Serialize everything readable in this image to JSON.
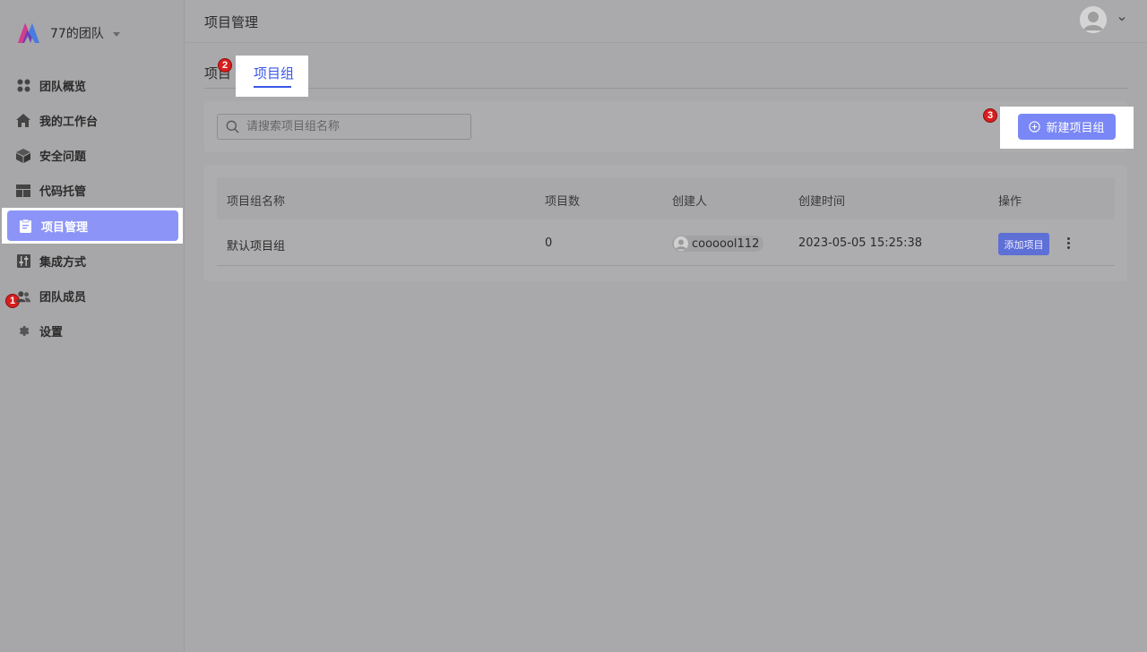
{
  "sidebar": {
    "team_name": "77的团队",
    "items": [
      {
        "label": "团队概览",
        "icon": "grid-icon"
      },
      {
        "label": "我的工作台",
        "icon": "home-icon"
      },
      {
        "label": "安全问题",
        "icon": "cube-icon"
      },
      {
        "label": "代码托管",
        "icon": "layout-icon"
      },
      {
        "label": "项目管理",
        "icon": "clipboard-icon",
        "active": true
      },
      {
        "label": "集成方式",
        "icon": "sliders-icon"
      },
      {
        "label": "团队成员",
        "icon": "users-icon"
      },
      {
        "label": "设置",
        "icon": "gear-icon"
      }
    ]
  },
  "header": {
    "title": "项目管理"
  },
  "tabs": {
    "projects": "项目",
    "groups": "项目组"
  },
  "toolbar": {
    "search_placeholder": "请搜索项目组名称",
    "new_group_label": "新建项目组"
  },
  "table": {
    "headers": [
      "项目组名称",
      "项目数",
      "创建人",
      "创建时间",
      "操作"
    ],
    "rows": [
      {
        "name": "默认项目组",
        "count": "0",
        "creator": "coooool112",
        "created_at": "2023-05-05 15:25:38",
        "action_label": "添加项目"
      }
    ]
  },
  "annotations": [
    "1",
    "2",
    "3"
  ],
  "colors": {
    "accent": "#3a57e8",
    "active_nav": "#8c95f7",
    "primary_button": "#7a87f6",
    "badge": "#d81e1e"
  }
}
